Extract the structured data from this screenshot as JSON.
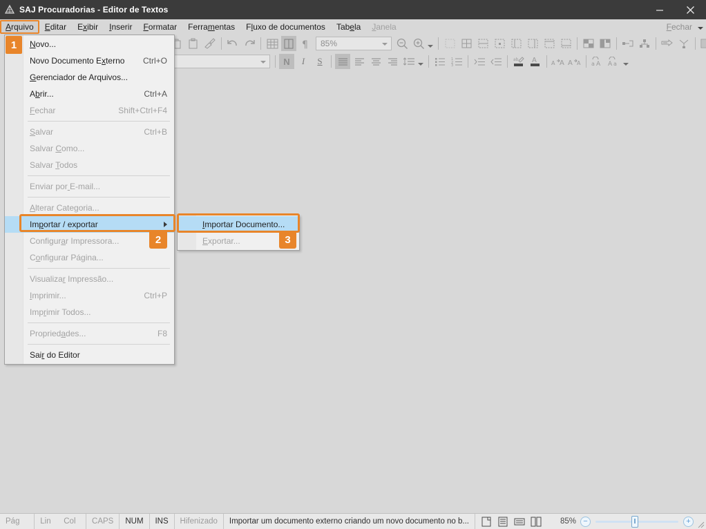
{
  "window": {
    "title": "SAJ Procuradorias - Editor de Textos",
    "app_icon": "saj-logo-icon",
    "minimize_label": "Minimizar",
    "close_label": "Fechar"
  },
  "menubar": {
    "items": [
      {
        "label": "Arquivo",
        "mnemonic_index": 0,
        "state": "active"
      },
      {
        "label": "Editar",
        "mnemonic_index": 0,
        "state": "normal"
      },
      {
        "label": "Exibir",
        "mnemonic_index": 1,
        "state": "normal"
      },
      {
        "label": "Inserir",
        "mnemonic_index": 0,
        "state": "normal"
      },
      {
        "label": "Formatar",
        "mnemonic_index": 0,
        "state": "normal"
      },
      {
        "label": "Ferramentas",
        "mnemonic_index": 5,
        "state": "normal"
      },
      {
        "label": "Fluxo de documentos",
        "mnemonic_index": 1,
        "state": "normal"
      },
      {
        "label": "Tabela",
        "mnemonic_index": 3,
        "state": "normal"
      },
      {
        "label": "Janela",
        "mnemonic_index": 0,
        "state": "disabled"
      }
    ],
    "right_close_label": "Fechar"
  },
  "toolbar": {
    "zoom_value": "85%",
    "font_value": "",
    "size_value": ""
  },
  "file_menu": {
    "items": [
      {
        "label": "Novo...",
        "accel": "",
        "state": "enabled",
        "type": "item"
      },
      {
        "label": "Novo Documento Externo",
        "accel": "Ctrl+O",
        "state": "enabled",
        "type": "item"
      },
      {
        "label": "Gerenciador de Arquivos...",
        "accel": "",
        "state": "enabled",
        "type": "item"
      },
      {
        "label": "Abrir...",
        "accel": "Ctrl+A",
        "state": "enabled",
        "type": "item"
      },
      {
        "label": "Fechar",
        "accel": "Shift+Ctrl+F4",
        "state": "disabled",
        "type": "item"
      },
      {
        "label": "",
        "accel": "",
        "state": "",
        "type": "separator"
      },
      {
        "label": "Salvar",
        "accel": "Ctrl+B",
        "state": "disabled",
        "type": "item"
      },
      {
        "label": "Salvar Como...",
        "accel": "",
        "state": "disabled",
        "type": "item"
      },
      {
        "label": "Salvar Todos",
        "accel": "",
        "state": "disabled",
        "type": "item"
      },
      {
        "label": "",
        "accel": "",
        "state": "",
        "type": "separator"
      },
      {
        "label": "Enviar por E-mail...",
        "accel": "",
        "state": "disabled",
        "type": "item"
      },
      {
        "label": "",
        "accel": "",
        "state": "",
        "type": "separator"
      },
      {
        "label": "Alterar Categoria...",
        "accel": "",
        "state": "disabled",
        "type": "item"
      },
      {
        "label": "Importar / exportar",
        "accel": "",
        "state": "highlighted",
        "type": "submenu"
      },
      {
        "label": "Configurar Impressora...",
        "accel": "",
        "state": "disabled",
        "type": "item"
      },
      {
        "label": "Configurar Página...",
        "accel": "",
        "state": "disabled",
        "type": "item"
      },
      {
        "label": "",
        "accel": "",
        "state": "",
        "type": "separator"
      },
      {
        "label": "Visualizar Impressão...",
        "accel": "",
        "state": "disabled",
        "type": "item"
      },
      {
        "label": "Imprimir...",
        "accel": "Ctrl+P",
        "state": "disabled",
        "type": "item"
      },
      {
        "label": "Imprimir Todos...",
        "accel": "",
        "state": "disabled",
        "type": "item"
      },
      {
        "label": "",
        "accel": "",
        "state": "",
        "type": "separator"
      },
      {
        "label": "Propriedades...",
        "accel": "F8",
        "state": "disabled",
        "type": "item"
      },
      {
        "label": "",
        "accel": "",
        "state": "",
        "type": "separator"
      },
      {
        "label": "Sair do Editor",
        "accel": "",
        "state": "enabled",
        "type": "item"
      }
    ]
  },
  "sub_menu": {
    "items": [
      {
        "label": "Importar Documento...",
        "accel": "",
        "state": "highlighted"
      },
      {
        "label": "Exportar...",
        "accel": "",
        "state": "disabled"
      }
    ]
  },
  "callouts": [
    {
      "number": "1",
      "target": "Arquivo menu"
    },
    {
      "number": "2",
      "target": "Importar / exportar"
    },
    {
      "number": "3",
      "target": "Importar Documento..."
    }
  ],
  "statusbar": {
    "pag_label": "Pág",
    "lin_label": "Lin",
    "col_label": "Col",
    "caps_label": "CAPS",
    "num_label": "NUM",
    "ins_label": "INS",
    "hifenizado_label": "Hifenizado",
    "message": "Importar um documento externo criando um novo documento no b...",
    "zoom_label": "85%",
    "zoom_percent": 85
  },
  "colors": {
    "accent_orange": "#e8852a",
    "titlebar_bg": "#3b3b3b",
    "app_bg": "#d8d8d8",
    "menu_bg": "#f0f0f0",
    "menu_highlight": "#b5dcf5",
    "statusbar_bg": "#e9e9e9"
  }
}
